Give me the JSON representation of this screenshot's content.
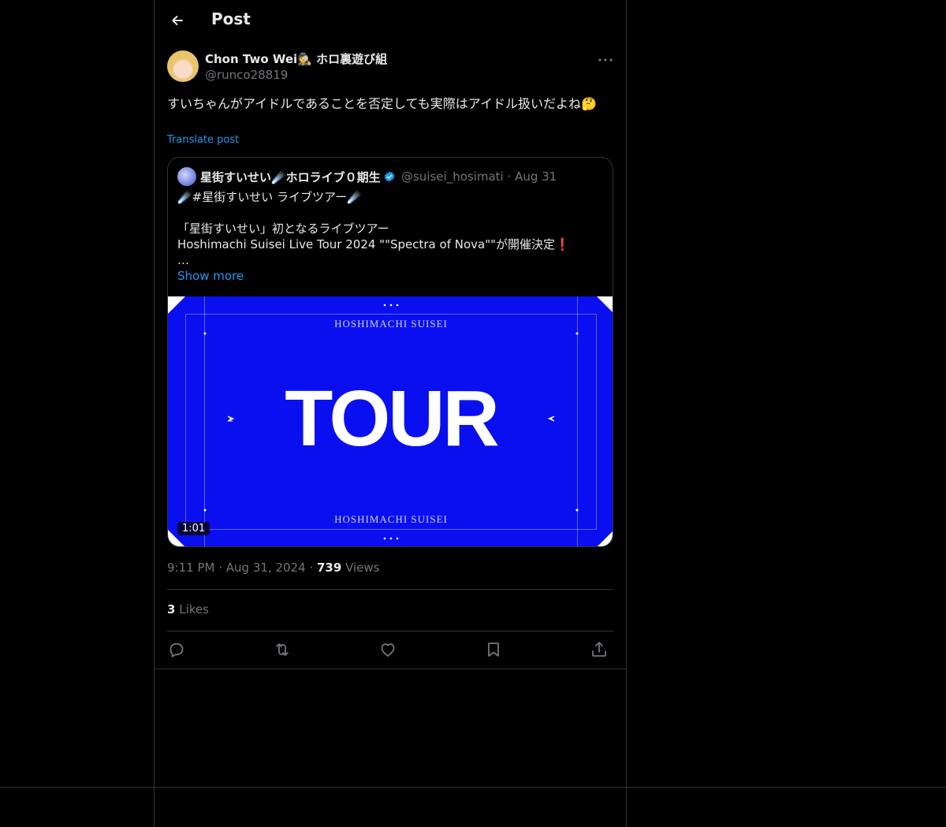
{
  "header": {
    "title": "Post"
  },
  "post": {
    "author_name": "Chon Two Wei🕵 ホロ裏遊び組",
    "author_handle": "@runco28819",
    "text": "すいちゃんがアイドルであることを否定しても実際はアイドル扱いだよね🤔",
    "translate_label": "Translate post",
    "time": "9:11 PM",
    "date": "Aug 31, 2024",
    "views_count": "739",
    "views_label": "Views",
    "likes_count": "3",
    "likes_label": "Likes"
  },
  "quote": {
    "author_name": "星街すいせい☄️ホロライブ０期生",
    "author_handle": "@suisei_hosimati",
    "date": "Aug 31",
    "text": "☄️#星街すいせい ライブツアー☄️\n\n「星街すいせい」初となるライブツアー\nHoshimachi Suisei Live Tour 2024 \"\"Spectra of Nova\"\"が開催決定❗️\n…",
    "show_more": "Show more",
    "media": {
      "title_text": "TOUR",
      "brand_text": "HOSHIMACHI SUISEI",
      "duration": "1:01",
      "bg_color": "#0a0ff0"
    }
  },
  "icons": {
    "back": "arrow-left-icon",
    "more": "more-horizontal-icon",
    "verified": "verified-badge-icon",
    "reply": "reply-icon",
    "repost": "repost-icon",
    "like": "heart-icon",
    "bookmark": "bookmark-icon",
    "share": "share-icon"
  },
  "colors": {
    "accent": "#1d9bf0",
    "muted": "#71767b",
    "border": "#2f3336",
    "background": "#000000"
  }
}
